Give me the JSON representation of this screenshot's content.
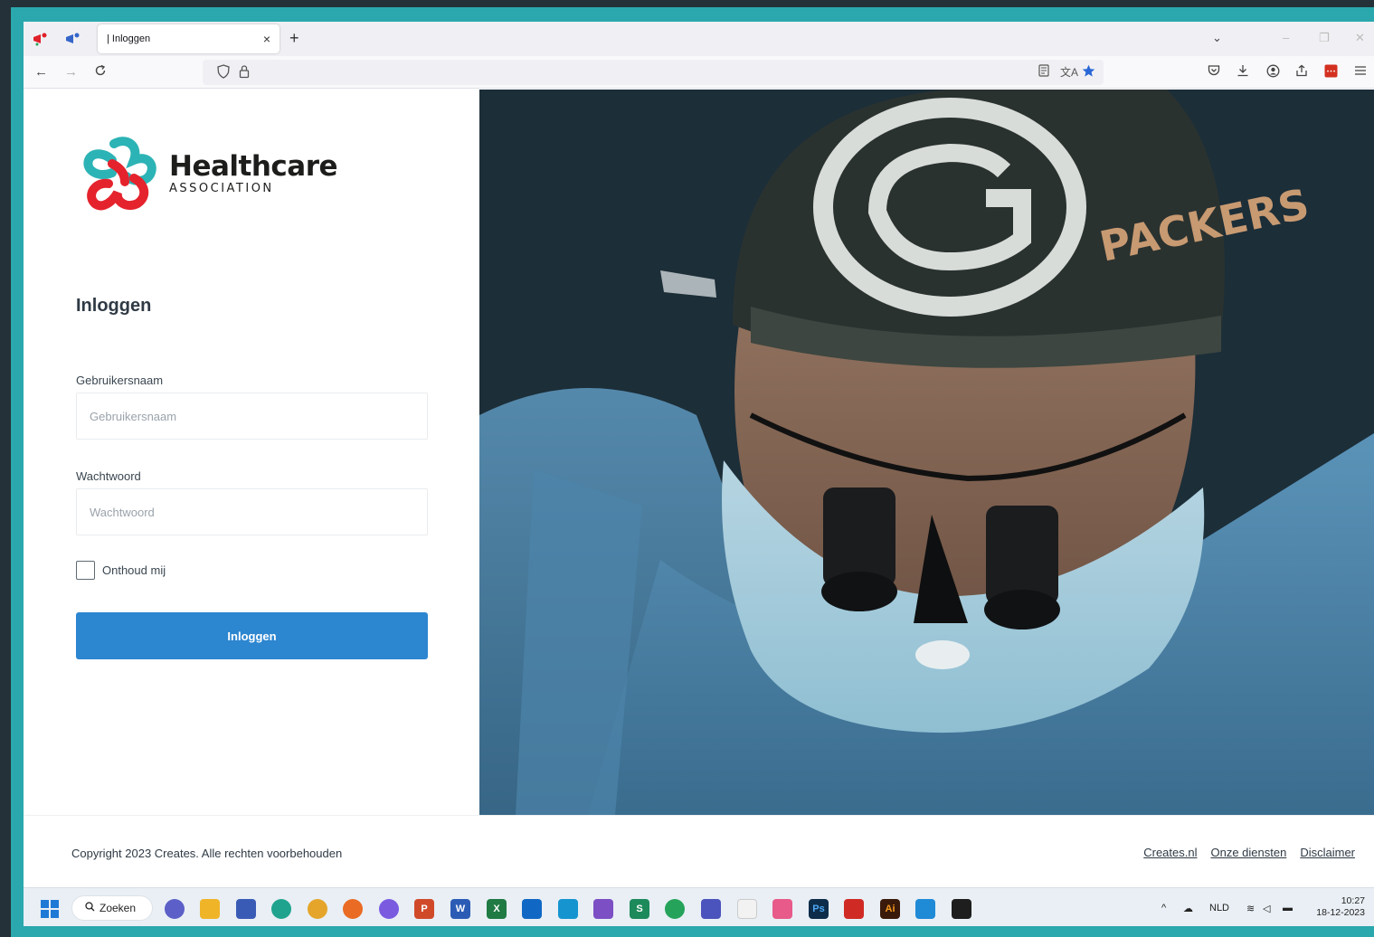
{
  "browser": {
    "tab_title": "| Inloggen",
    "tab_close": "×",
    "new_tab": "+",
    "window_controls": {
      "list": "⌄",
      "minimize": "–",
      "restore": "❐",
      "close": "✕"
    },
    "nav": {
      "back": "←",
      "forward": "→",
      "reload": "C"
    },
    "url_icons": [
      "shield-icon",
      "lock-icon"
    ],
    "address_right_icons": [
      "reader-view-icon",
      "translate-icon",
      "bookmark-star-icon"
    ],
    "toolbar_icons": [
      "pocket-icon",
      "download-icon",
      "account-icon",
      "share-icon",
      "extension-icon",
      "menu-icon"
    ]
  },
  "logo": {
    "title": "Healthcare",
    "subtitle": "ASSOCIATION",
    "colors": {
      "teal": "#2cb3b5",
      "red": "#e5232d"
    }
  },
  "login": {
    "heading": "Inloggen",
    "username_label": "Gebruikersnaam",
    "username_placeholder": "Gebruikersnaam",
    "username_value": "",
    "password_label": "Wachtwoord",
    "password_placeholder": "Wachtwoord",
    "password_value": "",
    "remember_label": "Onthoud mij",
    "remember_checked": false,
    "submit_label": "Inloggen",
    "button_color": "#2c86d0"
  },
  "footer": {
    "copyright": "Copyright 2023 Creates. Alle rechten voorbehouden",
    "links": [
      "Creates.nl",
      "Onze diensten",
      "Disclaimer"
    ]
  },
  "taskbar": {
    "search_label": "Zoeken",
    "language": "NLD",
    "time": "10:27",
    "date": "18-12-2023"
  }
}
